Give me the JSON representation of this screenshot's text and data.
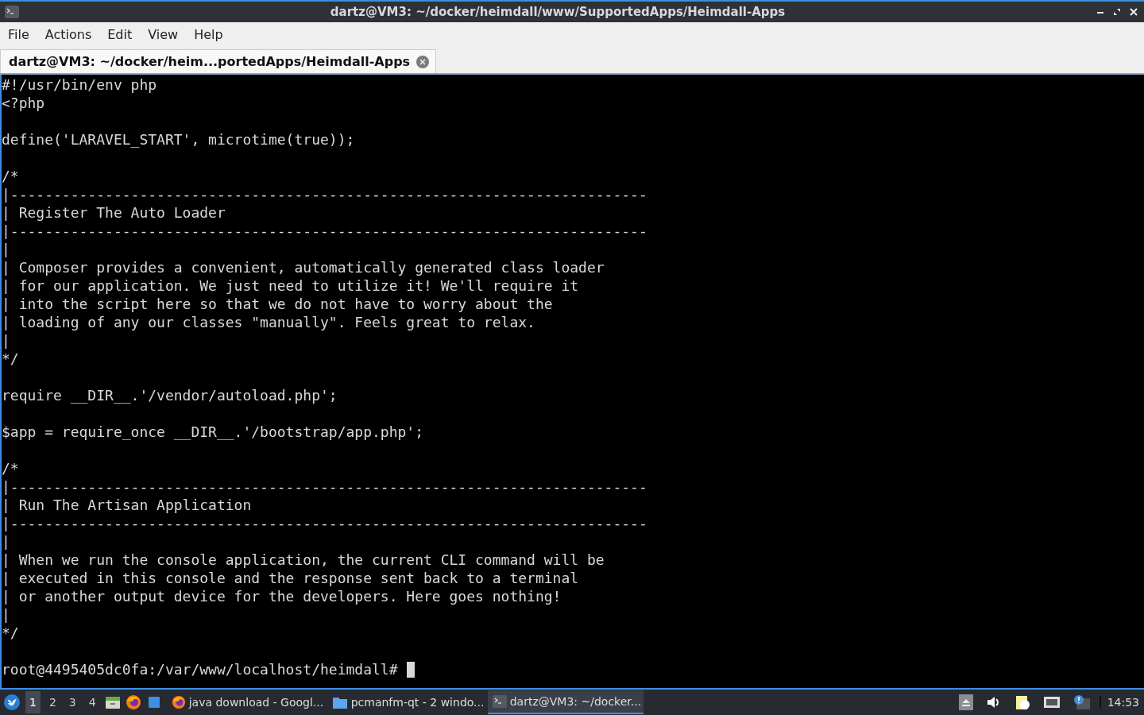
{
  "window": {
    "title": "dartz@VM3: ~/docker/heimdall/www/SupportedApps/Heimdall-Apps"
  },
  "menu": [
    "File",
    "Actions",
    "Edit",
    "View",
    "Help"
  ],
  "tabs": [
    {
      "label": "dartz@VM3: ~/docker/heim...portedApps/Heimdall-Apps",
      "selected": true
    }
  ],
  "terminal": {
    "blocks": [
      [
        "#!/usr/bin/env php",
        "<?php"
      ],
      [
        "define('LARAVEL_START', microtime(true));"
      ],
      [
        "/*",
        "|--------------------------------------------------------------------------",
        "| Register The Auto Loader",
        "|--------------------------------------------------------------------------",
        "|",
        "| Composer provides a convenient, automatically generated class loader",
        "| for our application. We just need to utilize it! We'll require it",
        "| into the script here so that we do not have to worry about the",
        "| loading of any our classes \"manually\". Feels great to relax.",
        "|",
        "*/"
      ],
      [
        "require __DIR__.'/vendor/autoload.php';"
      ],
      [
        "$app = require_once __DIR__.'/bootstrap/app.php';"
      ],
      [
        "/*",
        "|--------------------------------------------------------------------------",
        "| Run The Artisan Application",
        "|--------------------------------------------------------------------------",
        "|",
        "| When we run the console application, the current CLI command will be",
        "| executed in this console and the response sent back to a terminal",
        "| or another output device for the developers. Here goes nothing!",
        "|",
        "*/"
      ]
    ],
    "prompt": "root@4495405dc0fa:/var/www/localhost/heimdall#"
  },
  "taskbar": {
    "desktops": [
      {
        "label": "1",
        "selected": true
      },
      {
        "label": "2",
        "selected": false
      },
      {
        "label": "3",
        "selected": false
      },
      {
        "label": "4",
        "selected": false
      }
    ],
    "tasks": [
      {
        "label": "java download - Googl...",
        "kind": "browser",
        "selected": false
      },
      {
        "label": "pcmanfm-qt - 2 windo...",
        "kind": "folder",
        "selected": false
      },
      {
        "label": "dartz@VM3: ~/docker...",
        "kind": "terminal",
        "selected": true
      }
    ],
    "clock": "14:53"
  }
}
